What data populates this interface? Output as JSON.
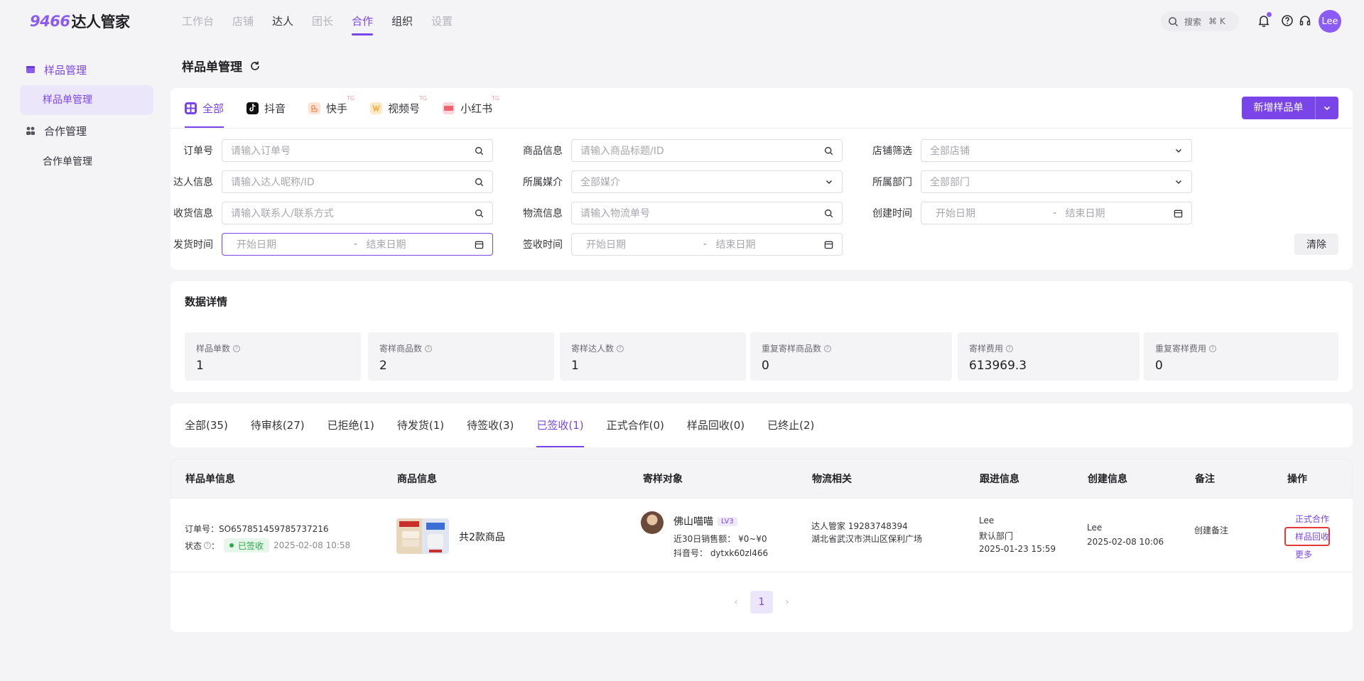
{
  "brand": {
    "logo_num": "9466",
    "logo_text": "达人管家"
  },
  "topnav": [
    "工作台",
    "店铺",
    "达人",
    "团长",
    "合作",
    "组织",
    "设置"
  ],
  "search": {
    "label": "搜索",
    "shortcut": "⌘ K"
  },
  "user": {
    "avatar_text": "Lee"
  },
  "sidebar": {
    "groups": [
      {
        "label": "样品管理",
        "items": [
          "样品单管理"
        ]
      },
      {
        "label": "合作管理",
        "items": [
          "合作单管理"
        ]
      }
    ]
  },
  "page": {
    "title": "样品单管理"
  },
  "platform_tabs": [
    "全部",
    "抖音",
    "快手",
    "视频号",
    "小红书"
  ],
  "platform_badge": "TG",
  "new_button": "新增样品单",
  "filters": {
    "order_no": {
      "label": "订单号",
      "placeholder": "请输入订单号"
    },
    "product": {
      "label": "商品信息",
      "placeholder": "请输入商品标题/ID"
    },
    "shop": {
      "label": "店铺筛选",
      "value": "全部店铺"
    },
    "creator": {
      "label": "达人信息",
      "placeholder": "请输入达人昵称/ID"
    },
    "media": {
      "label": "所属媒介",
      "value": "全部媒介"
    },
    "dept": {
      "label": "所属部门",
      "value": "全部部门"
    },
    "receiver": {
      "label": "收货信息",
      "placeholder": "请输入联系人/联系方式"
    },
    "logistics": {
      "label": "物流信息",
      "placeholder": "请输入物流单号"
    },
    "created": {
      "label": "创建时间",
      "start": "开始日期",
      "end": "结束日期",
      "sep": "-"
    },
    "shipped": {
      "label": "发货时间",
      "start": "开始日期",
      "end": "结束日期",
      "sep": "-"
    },
    "signed": {
      "label": "签收时间",
      "start": "开始日期",
      "end": "结束日期",
      "sep": "-"
    },
    "clear_label": "清除"
  },
  "data_details": {
    "title": "数据详情",
    "stats": [
      {
        "label": "样品单数",
        "value": "1"
      },
      {
        "label": "寄样商品数",
        "value": "2"
      },
      {
        "label": "寄样达人数",
        "value": "1"
      },
      {
        "label": "重复寄样商品数",
        "value": "0"
      },
      {
        "label": "寄样费用",
        "value": "613969.3"
      },
      {
        "label": "重复寄样费用",
        "value": "0"
      }
    ]
  },
  "status_tabs": [
    "全部(35)",
    "待审核(27)",
    "已拒绝(1)",
    "待发货(1)",
    "待签收(3)",
    "已签收(1)",
    "正式合作(0)",
    "样品回收(0)",
    "已终止(2)"
  ],
  "table": {
    "columns": [
      "样品单信息",
      "商品信息",
      "寄样对象",
      "物流相关",
      "跟进信息",
      "创建信息",
      "备注",
      "操作"
    ],
    "rows": [
      {
        "order_label": "订单号：",
        "order_no": "SO657851459785737216",
        "status_label": "状态",
        "status_colon": "：",
        "status": "已签收",
        "status_time": "2025-02-08 10:58",
        "product_count": "共2款商品",
        "creator_name": "佛山喵喵",
        "creator_level": "LV3",
        "creator_sales": "近30日销售额：  ¥0~¥0",
        "creator_douyin": "抖音号：  dytxk60zl466",
        "logistics_line1": "达人管家   19283748394",
        "logistics_line2": "湖北省武汉市洪山区保利广场",
        "follow_user": "Lee",
        "follow_dept": "默认部门",
        "follow_time": "2025-01-23 15:59",
        "create_user": "Lee",
        "create_time": "2025-02-08 10:06",
        "remark": "创建备注",
        "ops": [
          "正式合作",
          "样品回收",
          "更多"
        ]
      }
    ]
  },
  "pagination": {
    "current": "1"
  }
}
